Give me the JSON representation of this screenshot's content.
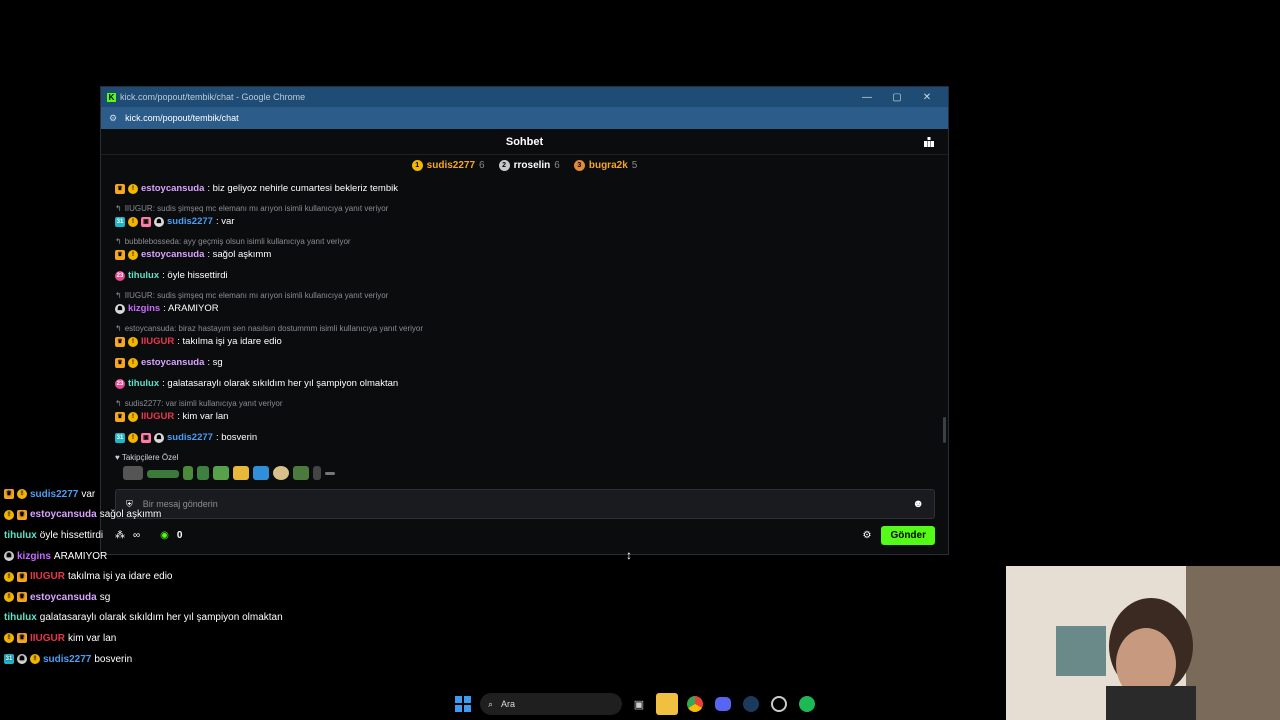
{
  "window": {
    "title": "kick.com/popout/tembik/chat - Google Chrome",
    "url": "kick.com/popout/tembik/chat",
    "minimize": "—",
    "maximize": "▢",
    "close": "✕"
  },
  "chat": {
    "title": "Sohbet",
    "top_gifters": [
      {
        "rank": "1",
        "name": "sudis2277",
        "count": "6",
        "color": "#f5a623",
        "medal": "#f5b600"
      },
      {
        "rank": "2",
        "name": "rroselin",
        "count": "6",
        "color": "#ffffff",
        "medal": "#c8c8c8"
      },
      {
        "rank": "3",
        "name": "bugra2k",
        "count": "5",
        "color": "#f5a623",
        "medal": "#e08a3c"
      }
    ],
    "messages": [
      {
        "reply": "",
        "badges": [
          "crown",
          "gold"
        ],
        "user": "estoycansuda",
        "color": "#d9a3ff",
        "text": ": biz geliyoz nehirle cumartesi bekleriz tembik"
      },
      {
        "reply": "IIUGUR: sudis şimşeq mc elemanı mı arıyon isimli kullanıcıya yanıt veriyor",
        "badges": [
          "sub",
          "gold",
          "gift",
          "hat"
        ],
        "user": "sudis2277",
        "color": "#4a9ff5",
        "text": ": var"
      },
      {
        "reply": "bubblebosseda: ayy geçmiş olsun isimli kullanıcıya yanıt veriyor",
        "badges": [
          "crown",
          "gold"
        ],
        "user": "estoycansuda",
        "color": "#d9a3ff",
        "text": ": sağol aşkımm"
      },
      {
        "reply": "",
        "badges": [
          "pink"
        ],
        "user": "tihulux",
        "color": "#5fe0c8",
        "text": ": öyle hissettirdi"
      },
      {
        "reply": "IIUGUR: sudis şimşeq mc elemanı mı arıyon isimli kullanıcıya yanıt veriyor",
        "badges": [
          "hat"
        ],
        "user": "kizgins",
        "color": "#c86bff",
        "text": ": ARAMIYOR"
      },
      {
        "reply": "estoycansuda: biraz hastayım sen nasılsın dostummm isimli kullanıcıya yanıt veriyor",
        "badges": [
          "crown",
          "gold"
        ],
        "user": "IIUGUR",
        "color": "#e8364b",
        "text": ": takılma işi ya idare edio"
      },
      {
        "reply": "",
        "badges": [
          "crown",
          "gold"
        ],
        "user": "estoycansuda",
        "color": "#d9a3ff",
        "text": ": sg"
      },
      {
        "reply": "",
        "badges": [
          "pink"
        ],
        "user": "tihulux",
        "color": "#5fe0c8",
        "text": ": galatasaraylı olarak sıkıldım her yıl şampiyon olmaktan"
      },
      {
        "reply": "sudis2277: var isimli kullanıcıya yanıt veriyor",
        "badges": [
          "crown",
          "gold"
        ],
        "user": "IIUGUR",
        "color": "#e8364b",
        "text": ": kim var lan"
      },
      {
        "reply": "",
        "badges": [
          "sub",
          "gold",
          "gift",
          "hat"
        ],
        "user": "sudis2277",
        "color": "#4a9ff5",
        "text": ": bosverin"
      }
    ],
    "emote_section": "Takipçilere Özel",
    "input_placeholder": "Bir mesaj gönderin",
    "viewers": "∞",
    "points": "0",
    "send_label": "Gönder"
  },
  "overlay": [
    {
      "user": "sudis2277",
      "color": "#4a9ff5",
      "text": "var"
    },
    {
      "user": "estoycansuda",
      "color": "#d9a3ff",
      "text": "sağol aşkımm"
    },
    {
      "user": "tihulux",
      "color": "#5fe0c8",
      "text": "öyle hissettirdi"
    },
    {
      "user": "kizgins",
      "color": "#c86bff",
      "text": "ARAMIYOR"
    },
    {
      "user": "IIUGUR",
      "color": "#e8364b",
      "text": "takılma işi ya idare edio"
    },
    {
      "user": "estoycansuda",
      "color": "#d9a3ff",
      "text": "sg"
    },
    {
      "user": "tihulux",
      "color": "#5fe0c8",
      "text": "galatasaraylı olarak sıkıldım her yıl şampiyon olmaktan"
    },
    {
      "user": "IIUGUR",
      "color": "#e8364b",
      "text": "kim var lan"
    },
    {
      "user": "sudis2277",
      "color": "#4a9ff5",
      "text": "bosverin"
    }
  ],
  "taskbar": {
    "search_label": "Ara",
    "icons": [
      "windows-start-icon",
      "task-view-icon",
      "file-explorer-icon",
      "chrome-icon",
      "discord-icon",
      "steam-icon",
      "app-icon",
      "spotify-icon"
    ]
  }
}
